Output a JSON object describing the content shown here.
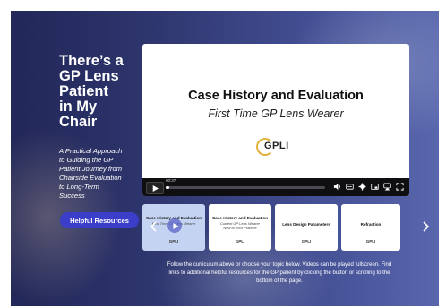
{
  "hero": {
    "title_lines": [
      "There’s a",
      "GP Lens",
      "Patient",
      "in My",
      "Chair"
    ],
    "subtitle_lines": [
      "A Practical Approach",
      "to Guiding the GP",
      "Patient Journey from",
      "Chairside Evaluation",
      "to Long-Term",
      "Success"
    ],
    "resources_button": "Helpful Resources"
  },
  "player": {
    "title": "Case History and Evaluation",
    "subtitle": "First Time GP Lens Wearer",
    "logo_text": "GPLI",
    "time": "00:37",
    "progress": 0.02,
    "control_icons": [
      "volume-icon",
      "captions-icon",
      "settings-icon",
      "pip-icon",
      "airplay-icon",
      "fullscreen-icon"
    ]
  },
  "carousel": {
    "tiles": [
      {
        "title": "Case History and Evaluation",
        "subtitle_lines": [
          "First Time GP Lens Wearer"
        ],
        "logo": "GPLI",
        "active": true
      },
      {
        "title": "Case History and Evaluation",
        "subtitle_lines": [
          "Current GP Lens Wearer",
          "New to Your Practice"
        ],
        "logo": "GPLI",
        "active": false
      },
      {
        "title": "Lens Design Parameters",
        "subtitle_lines": [],
        "logo": "GPLI",
        "active": false
      },
      {
        "title": "Refraction",
        "subtitle_lines": [],
        "logo": "GPLI",
        "active": false
      }
    ]
  },
  "footer": {
    "lines": [
      "Follow the curriculum above or choose your topic below. Videos can be played fullscreen. Find",
      "links to additional helpful resources for the GP patient by clicking the button or scrolling to the",
      "bottom of the page."
    ]
  },
  "colors": {
    "accent_button": "#3a3ec8",
    "logo_gold": "#e2b13c",
    "active_tile": "#c5d3f2"
  }
}
